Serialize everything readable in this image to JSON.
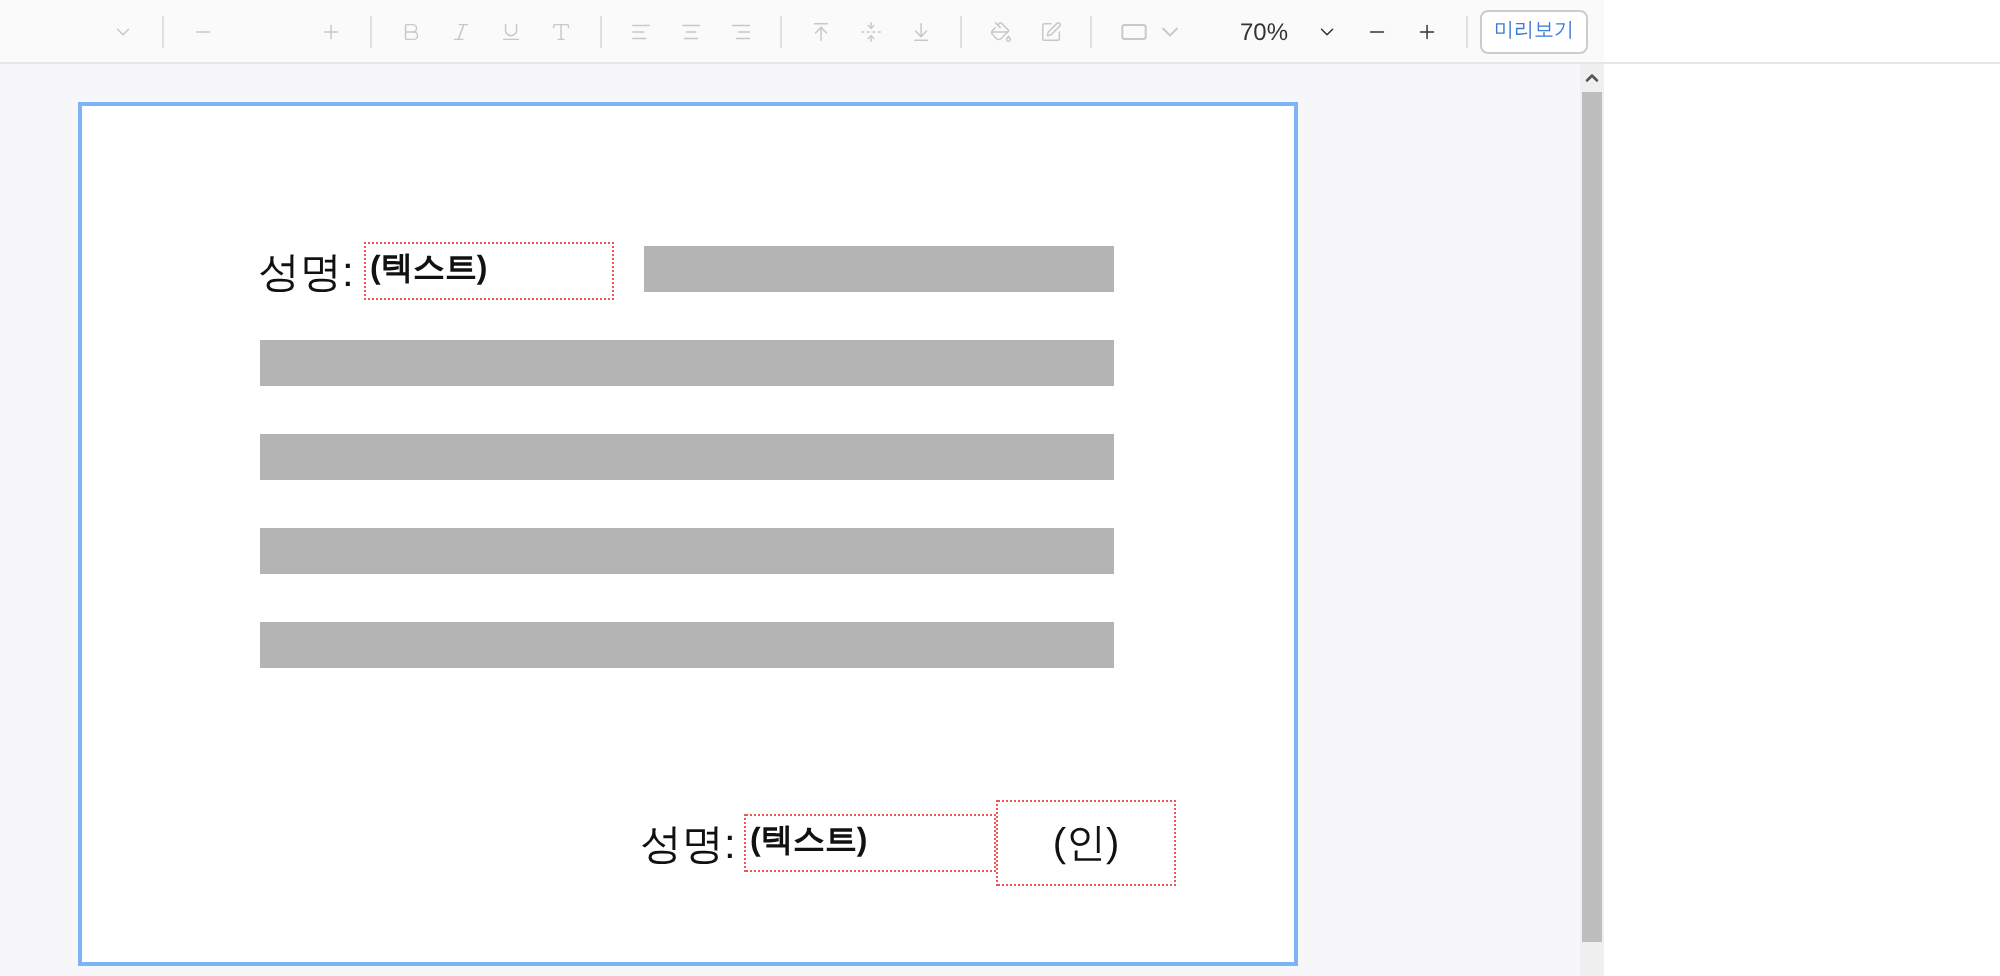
{
  "toolbar": {
    "zoom": "70%",
    "preview_button": "미리보기"
  },
  "page": {
    "top_name": {
      "label": "성명:",
      "field": "(텍스트)"
    },
    "bottom_name": {
      "label": "성명:",
      "field": "(텍스트)",
      "seal": "(인)"
    }
  }
}
